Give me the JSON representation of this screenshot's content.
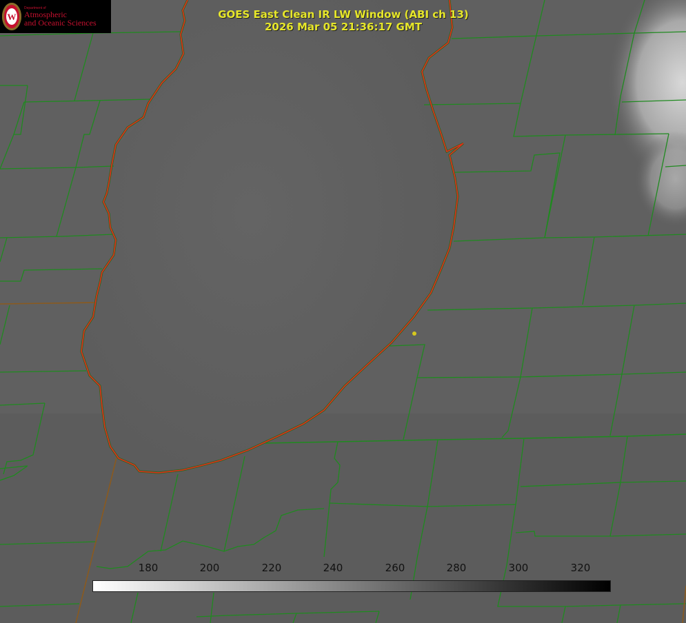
{
  "header": {
    "title": "GOES East Clean IR LW Window (ABI ch 13)",
    "timestamp": "2026 Mar 05 21:36:17 GMT"
  },
  "logo": {
    "department": "Department of",
    "name_line1": "Atmospheric",
    "name_line2": "and Oceanic Sciences",
    "emblem": "W"
  },
  "colorbar": {
    "ticks": [
      "180",
      "200",
      "220",
      "240",
      "260",
      "280",
      "300",
      "320"
    ]
  },
  "colors": {
    "background_gray": "#5f5f5f",
    "county_lines": "#1f8a1f",
    "coastline": "#e52b1c",
    "title_text": "#e6e62a",
    "logo_red": "#c5102f"
  }
}
